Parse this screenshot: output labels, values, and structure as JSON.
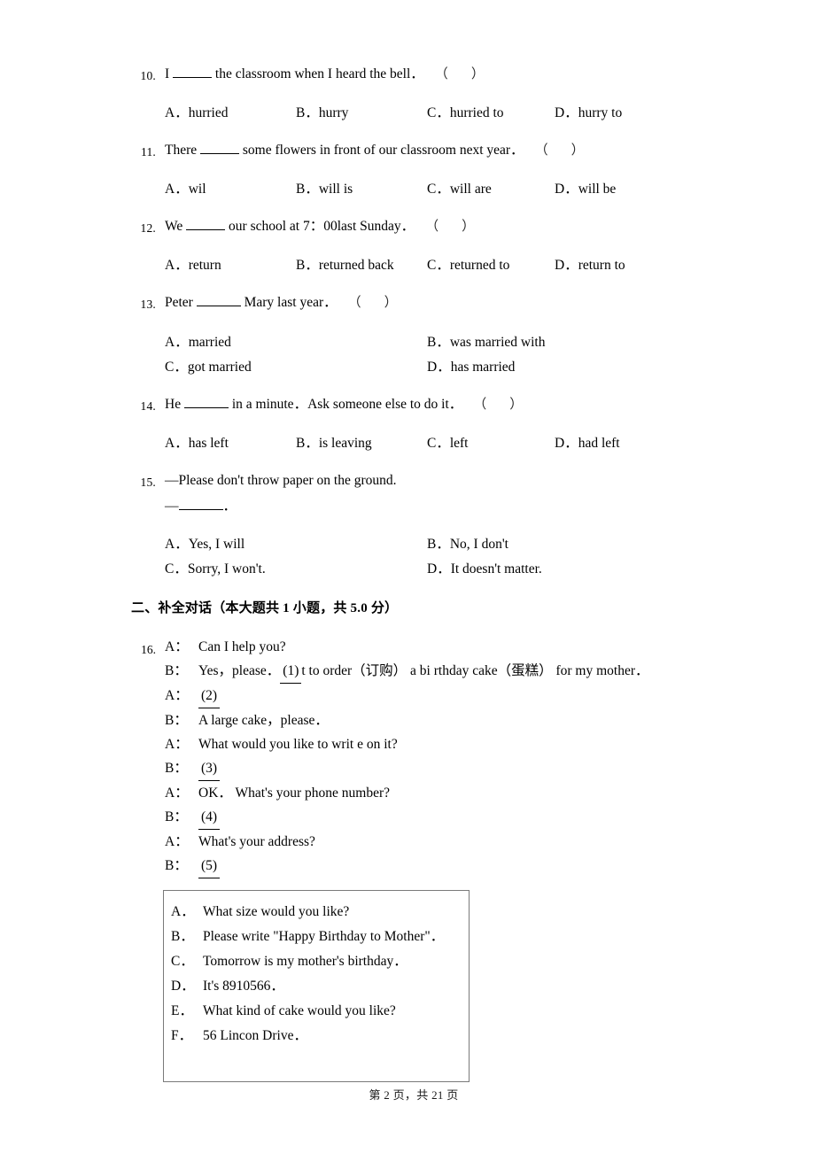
{
  "document": {
    "footer": "第 2 页，共 21 页"
  },
  "questions": [
    {
      "number": "10.",
      "stem_before": "I",
      "stem_after": "the classroom when I heard the bell．",
      "marker_open": "（",
      "marker_close": "）",
      "layout": "four-column",
      "options": [
        "A．hurried",
        "B．hurry",
        "C．hurried to",
        "D．hurry to"
      ]
    },
    {
      "number": "11.",
      "stem_before": "There",
      "stem_after": "some flowers in front of our classroom next year．",
      "marker_open": "（",
      "marker_close": "）",
      "layout": "four-column",
      "options": [
        "A．wil",
        "B．will is",
        "C．will are",
        "D．will be"
      ]
    },
    {
      "number": "12.",
      "stem_before": "We",
      "stem_after": "our school at 7：00last Sunday．",
      "marker_open": "（",
      "marker_close": "）",
      "layout": "four-column",
      "options": [
        "A．return",
        "B．returned back",
        "C．returned to",
        "D．return to"
      ]
    },
    {
      "number": "13.",
      "stem_before": "Peter",
      "stem_after": "Mary last year．",
      "marker_open": "（",
      "marker_close": "）",
      "layout": "two-column",
      "options": [
        "A．married",
        "B．was married with",
        "C．got married",
        "D．has married"
      ]
    },
    {
      "number": "14.",
      "stem_before": "He",
      "stem_after": "in a minute．Ask someone else to do it．",
      "marker_open": "（",
      "marker_close": "）",
      "layout": "four-column",
      "options": [
        "A．has left",
        "B．is leaving",
        "C．left",
        "D．had left"
      ]
    }
  ],
  "question15": {
    "number": "15.",
    "line1": "—Please don't throw paper on the ground.",
    "line2_dash": "—",
    "line2_end": "．",
    "options": [
      "A．Yes, I will",
      "B．No, I don't",
      "C．Sorry, I won't.",
      "D．It doesn't matter."
    ]
  },
  "section2": {
    "heading": "二、补全对话（本大题共 1 小题，共 5.0 分）"
  },
  "dialogue": {
    "number": "16.",
    "lines": [
      {
        "speaker": "A：",
        "text": "Can I help you?"
      },
      {
        "speaker": "B：",
        "text": "Yes，please．",
        "blank": " (1) ",
        "text_after": "t to order（订购） a bi rthday cake（蛋糕） for my mother．"
      },
      {
        "speaker": "A：",
        "blank": " (2) "
      },
      {
        "speaker": "B：",
        "text": "A large cake，please．"
      },
      {
        "speaker": "A：",
        "text": "What would you like to writ e on it?"
      },
      {
        "speaker": "B：",
        "blank": " (3) "
      },
      {
        "speaker": "A：",
        "text": "OK． What's your phone number?"
      },
      {
        "speaker": "B：",
        "blank": " (4) "
      },
      {
        "speaker": "A：",
        "text": "What's your address?"
      },
      {
        "speaker": "B：",
        "blank": " (5) "
      }
    ]
  },
  "choices_box": {
    "items": [
      {
        "label": "A．",
        "text": "What size would you like?"
      },
      {
        "label": "B．",
        "text": "Please write \"Happy Birthday to Mother\"．"
      },
      {
        "label": "C．",
        "text": "Tomorrow is my mother's birthday．"
      },
      {
        "label": "D．",
        "text": "It's 8910566．"
      },
      {
        "label": "E．",
        "text": "What kind of cake would you like?"
      },
      {
        "label": "F．",
        "text": "56 Lincon Drive．"
      }
    ]
  }
}
